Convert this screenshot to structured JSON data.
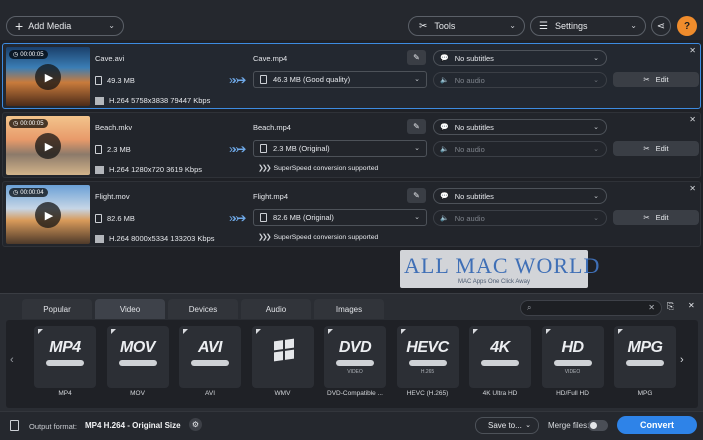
{
  "toolbar": {
    "add_media": "Add Media",
    "tools": "Tools",
    "settings": "Settings",
    "help": "?"
  },
  "files": [
    {
      "duration": "00:00:05",
      "input_name": "Cave.avi",
      "input_size": "49.3 MB",
      "input_meta": "H.264 5758x3838 79447 Kbps",
      "output_name": "Cave.mp4",
      "output_size": "46.3 MB (Good quality)",
      "superspeed": "",
      "subtitles": "No subtitles",
      "audio": "No audio",
      "edit": "Edit",
      "selected": true
    },
    {
      "duration": "00:00:05",
      "input_name": "Beach.mkv",
      "input_size": "2.3 MB",
      "input_meta": "H.264 1280x720 3619 Kbps",
      "output_name": "Beach.mp4",
      "output_size": "2.3 MB (Original)",
      "superspeed": "SuperSpeed conversion supported",
      "subtitles": "No subtitles",
      "audio": "No audio",
      "edit": "Edit",
      "selected": false
    },
    {
      "duration": "00:00:04",
      "input_name": "Flight.mov",
      "input_size": "82.6 MB",
      "input_meta": "H.264 8000x5334 133203 Kbps",
      "output_name": "Flight.mp4",
      "output_size": "82.6 MB (Original)",
      "superspeed": "SuperSpeed conversion supported",
      "subtitles": "No subtitles",
      "audio": "No audio",
      "edit": "Edit",
      "selected": false
    }
  ],
  "watermark": {
    "title": "ALL MAC WORLD",
    "subtitle": "MAC Apps One Click Away"
  },
  "format_tabs": {
    "items": [
      "Popular",
      "Video",
      "Devices",
      "Audio",
      "Images"
    ],
    "active": "Video"
  },
  "presets": [
    {
      "logo": "MP4",
      "logo_sub": "",
      "label": "MP4"
    },
    {
      "logo": "MOV",
      "logo_sub": "",
      "label": "MOV"
    },
    {
      "logo": "AVI",
      "logo_sub": "",
      "label": "AVI"
    },
    {
      "logo": "",
      "logo_sub": "",
      "label": "WMV"
    },
    {
      "logo": "DVD",
      "logo_sub": "VIDEO",
      "label": "DVD-Compatible ..."
    },
    {
      "logo": "HEVC",
      "logo_sub": "H.265",
      "label": "HEVC (H.265)"
    },
    {
      "logo": "4K",
      "logo_sub": "",
      "label": "4K Ultra HD"
    },
    {
      "logo": "HD",
      "logo_sub": "VIDEO",
      "label": "HD/Full HD"
    },
    {
      "logo": "MPG",
      "logo_sub": "",
      "label": "MPG"
    }
  ],
  "footer": {
    "output_format_label": "Output format:",
    "output_format_value": "MP4 H.264 - Original Size",
    "save_to": "Save to...",
    "merge_files": "Merge files:",
    "merge_enabled": false,
    "convert": "Convert"
  },
  "colors": {
    "accent": "#2e83e8",
    "help": "#f08c2c",
    "selection": "#3d8be0"
  }
}
